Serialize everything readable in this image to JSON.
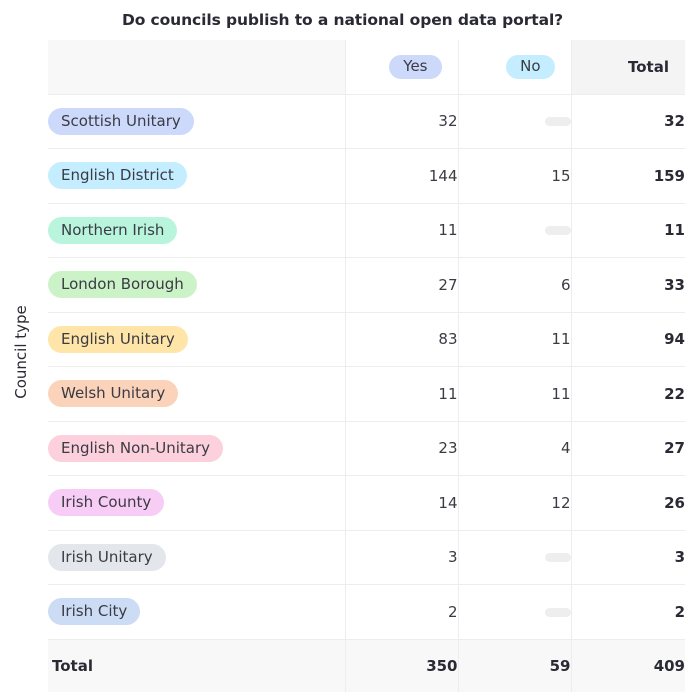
{
  "title": "Do councils publish to a national open data portal?",
  "axis": {
    "y_label": "Council type"
  },
  "columns": {
    "label_header": "",
    "yes": "Yes",
    "no": "No",
    "total": "Total"
  },
  "colors": {
    "pill_yes": "#ccd9fb",
    "pill_no": "#c4eeff",
    "total_col_bg": "#f8f8f8",
    "header_bg": "#f8f8f8",
    "grid_line": "#ededed",
    "text": "#2a2a35",
    "empty_placeholder": "#eeeeee"
  },
  "empty_marker": "",
  "rows": [
    {
      "label": "Scottish Unitary",
      "color": "#ccd9fb",
      "yes": "32",
      "no": "",
      "total": "32"
    },
    {
      "label": "English District",
      "color": "#c4eeff",
      "yes": "144",
      "no": "15",
      "total": "159"
    },
    {
      "label": "Northern Irish",
      "color": "#b9f5dd",
      "yes": "11",
      "no": "",
      "total": "11"
    },
    {
      "label": "London Borough",
      "color": "#ccf2c8",
      "yes": "27",
      "no": "6",
      "total": "33"
    },
    {
      "label": "English Unitary",
      "color": "#ffe5a8",
      "yes": "83",
      "no": "11",
      "total": "94"
    },
    {
      "label": "Welsh Unitary",
      "color": "#fbd3bb",
      "yes": "11",
      "no": "11",
      "total": "22"
    },
    {
      "label": "English Non-Unitary",
      "color": "#fcd0dc",
      "yes": "23",
      "no": "4",
      "total": "27"
    },
    {
      "label": "Irish County",
      "color": "#f7cdf6",
      "yes": "14",
      "no": "12",
      "total": "26"
    },
    {
      "label": "Irish Unitary",
      "color": "#e3e6ea",
      "yes": "3",
      "no": "",
      "total": "3"
    },
    {
      "label": "Irish City",
      "color": "#ccdcf5",
      "yes": "2",
      "no": "",
      "total": "2"
    }
  ],
  "total_row": {
    "label": "Total",
    "yes": "350",
    "no": "59",
    "total": "409"
  },
  "chart_data": {
    "type": "table",
    "title": "Do councils publish to a national open data portal?",
    "xlabel": "",
    "ylabel": "Council type",
    "categories": [
      "Scottish Unitary",
      "English District",
      "Northern Irish",
      "London Borough",
      "English Unitary",
      "Welsh Unitary",
      "English Non-Unitary",
      "Irish County",
      "Irish Unitary",
      "Irish City"
    ],
    "columns": [
      "Yes",
      "No",
      "Total"
    ],
    "series": [
      {
        "name": "Yes",
        "values": [
          32,
          144,
          11,
          27,
          83,
          11,
          23,
          14,
          3,
          2
        ]
      },
      {
        "name": "No",
        "values": [
          null,
          15,
          null,
          6,
          11,
          11,
          4,
          12,
          null,
          null
        ]
      },
      {
        "name": "Total",
        "values": [
          32,
          159,
          11,
          33,
          94,
          22,
          27,
          26,
          3,
          2
        ]
      }
    ],
    "column_totals": {
      "Yes": 350,
      "No": 59,
      "Total": 409
    },
    "grid": true,
    "legend": "none"
  }
}
